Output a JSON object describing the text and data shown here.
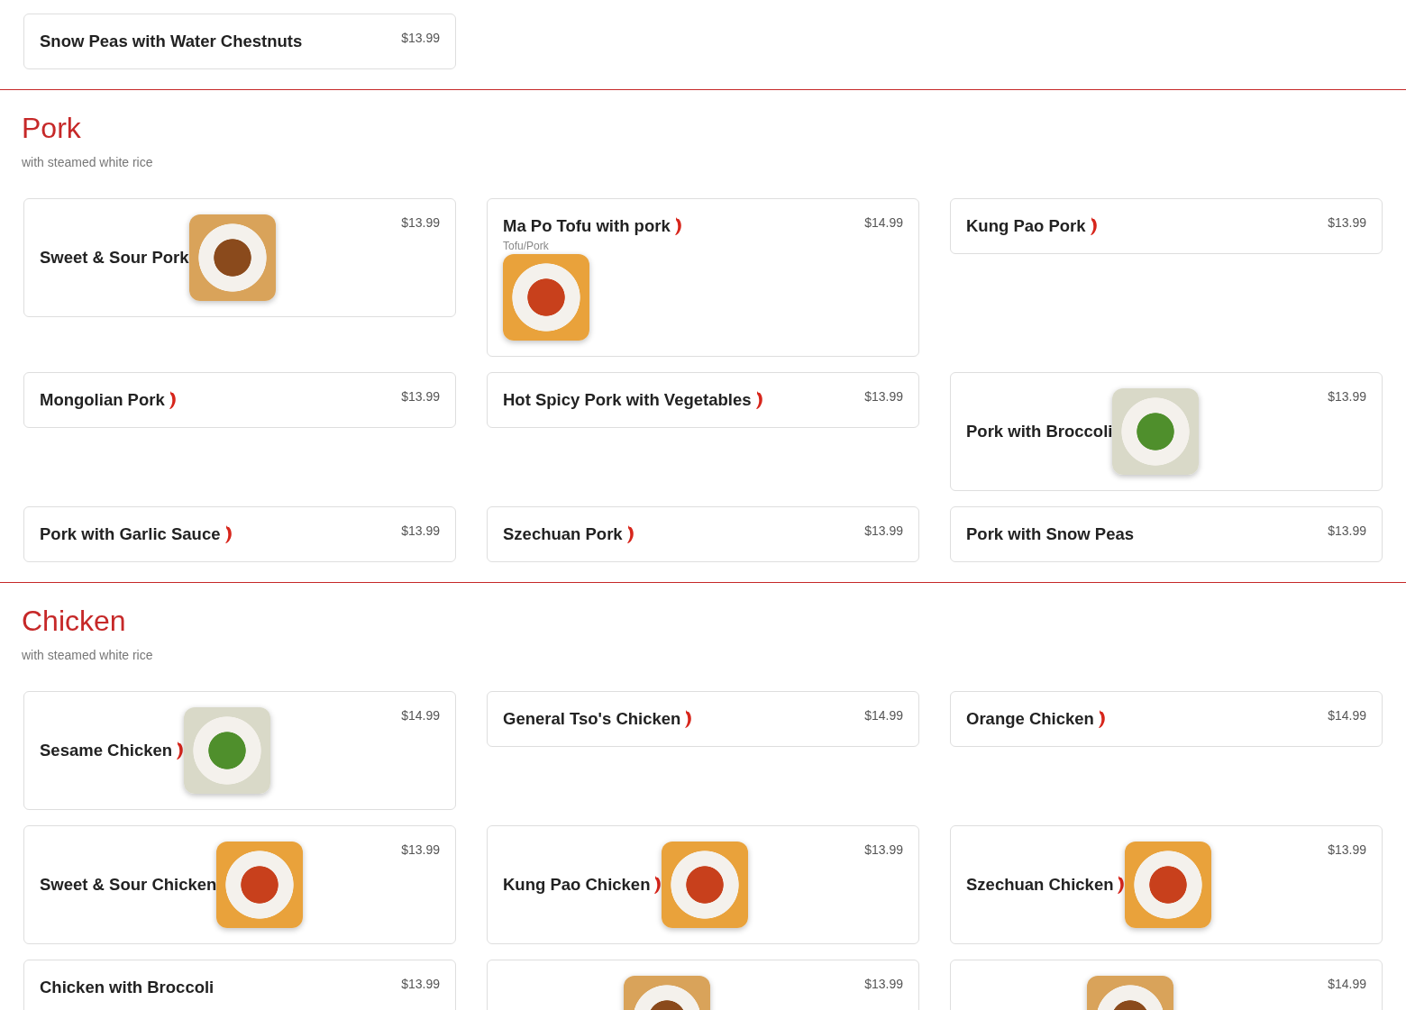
{
  "sections": [
    {
      "items": [
        {
          "kind": "plain",
          "name": "Snow Peas with Water Chestnuts",
          "price": "$13.99"
        }
      ]
    },
    {
      "title": "Pork",
      "note": "with steamed white rice",
      "items": [
        {
          "kind": "photo",
          "name": "Sweet & Sour Pork",
          "price": "$13.99"
        },
        {
          "kind": "photo-below",
          "name": "Ma Po Tofu with pork",
          "description": "Tofu/Pork",
          "spicy": true,
          "price": "$14.99"
        },
        {
          "kind": "plain",
          "name": "Kung Pao Pork",
          "spicy": true,
          "price": "$13.99"
        },
        {
          "kind": "plain",
          "name": "Mongolian Pork",
          "spicy": true,
          "price": "$13.99"
        },
        {
          "kind": "plain",
          "name": "Hot Spicy Pork with Vegetables",
          "spicy": true,
          "price": "$13.99"
        },
        {
          "kind": "photo",
          "name": "Pork with Broccoli",
          "price": "$13.99"
        },
        {
          "kind": "plain",
          "name": "Pork with Garlic Sauce",
          "spicy": true,
          "price": "$13.99"
        },
        {
          "kind": "plain",
          "name": "Szechuan Pork",
          "spicy": true,
          "price": "$13.99"
        },
        {
          "kind": "plain",
          "name": "Pork with Snow Peas",
          "price": "$13.99"
        }
      ]
    },
    {
      "title": "Chicken",
      "note": "with steamed white rice",
      "items": [
        {
          "kind": "photo",
          "name": "Sesame Chicken",
          "spicy": true,
          "price": "$14.99"
        },
        {
          "kind": "plain",
          "name": "General Tso's Chicken",
          "spicy": true,
          "price": "$14.99"
        },
        {
          "kind": "plain",
          "name": "Orange Chicken",
          "spicy": true,
          "price": "$14.99"
        },
        {
          "kind": "photo",
          "name": "Sweet & Sour Chicken",
          "price": "$13.99"
        },
        {
          "kind": "photo",
          "name": "Kung Pao Chicken",
          "spicy": true,
          "price": "$13.99"
        },
        {
          "kind": "photo",
          "name": "Szechuan Chicken",
          "spicy": true,
          "price": "$13.99"
        },
        {
          "kind": "plain",
          "name": "Chicken with Broccoli",
          "price": "$13.99"
        },
        {
          "kind": "photo",
          "price": "$13.99"
        },
        {
          "kind": "photo",
          "price": "$14.99"
        }
      ]
    }
  ]
}
